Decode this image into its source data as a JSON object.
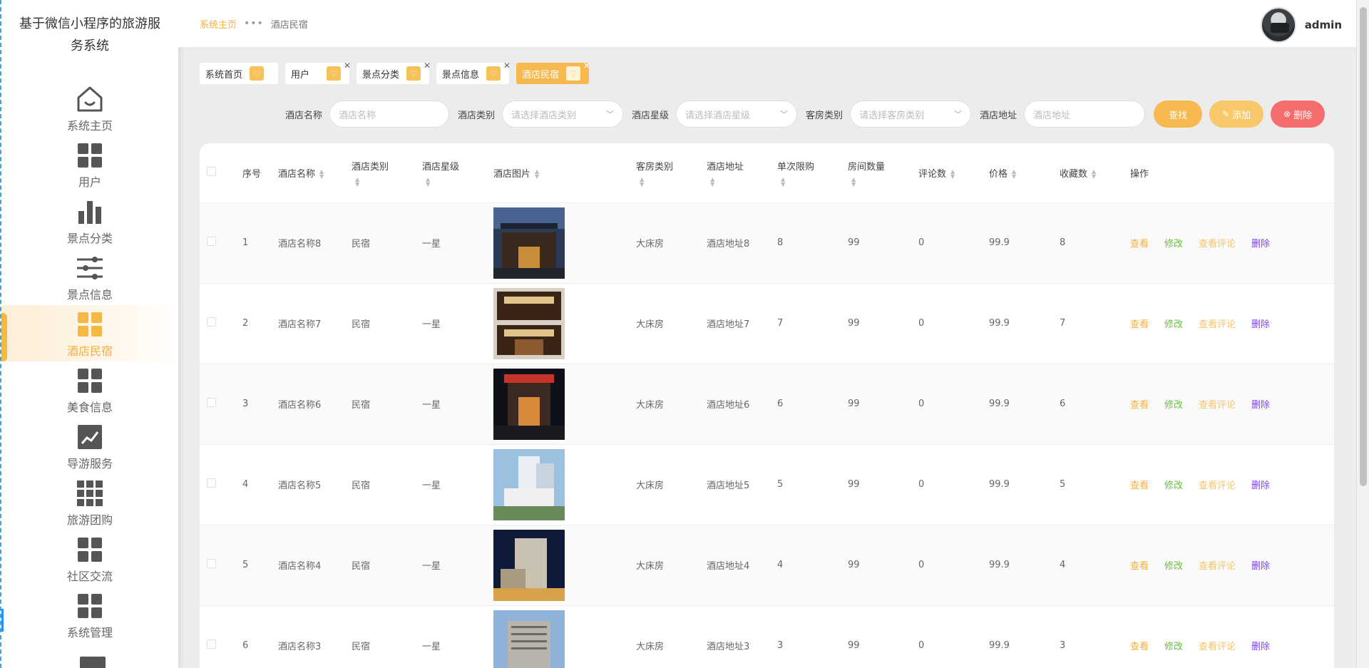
{
  "app": {
    "title": "基于微信小程序的旅游服务系统"
  },
  "sidebar": {
    "items": [
      {
        "label": "系统主页",
        "icon": "home-icon"
      },
      {
        "label": "用户",
        "icon": "grid-icon"
      },
      {
        "label": "景点分类",
        "icon": "bar-chart-icon"
      },
      {
        "label": "景点信息",
        "icon": "sliders-icon"
      },
      {
        "label": "酒店民宿",
        "icon": "grid-icon",
        "active": true
      },
      {
        "label": "美食信息",
        "icon": "grid-icon"
      },
      {
        "label": "导游服务",
        "icon": "trend-chart-icon"
      },
      {
        "label": "旅游团购",
        "icon": "apps-icon"
      },
      {
        "label": "社区交流",
        "icon": "grid-icon"
      },
      {
        "label": "系统管理",
        "icon": "grid-icon"
      }
    ]
  },
  "header": {
    "breadcrumb": [
      "系统主页",
      "酒店民宿"
    ],
    "breadcrumb_sep": "•••",
    "user": "admin"
  },
  "tags": [
    {
      "label": "系统首页",
      "closable": false
    },
    {
      "label": "用户",
      "closable": true
    },
    {
      "label": "景点分类",
      "closable": true
    },
    {
      "label": "景点信息",
      "closable": true
    },
    {
      "label": "酒店民宿",
      "closable": true,
      "active": true
    }
  ],
  "filters": {
    "hotel_name": {
      "label": "酒店名称",
      "placeholder": "酒店名称"
    },
    "hotel_type": {
      "label": "酒店类别",
      "placeholder": "请选择酒店类别"
    },
    "hotel_star": {
      "label": "酒店星级",
      "placeholder": "请选择酒店星级"
    },
    "room_type": {
      "label": "客房类别",
      "placeholder": "请选择客房类别"
    },
    "hotel_addr": {
      "label": "酒店地址",
      "placeholder": "酒店地址"
    },
    "search_btn": "查找",
    "add_btn": "添加",
    "delete_btn": "删除"
  },
  "table": {
    "columns": [
      "序号",
      "酒店名称",
      "酒店类别",
      "酒店星级",
      "酒店图片",
      "客房类别",
      "酒店地址",
      "单次限购",
      "房间数量",
      "评论数",
      "价格",
      "收藏数",
      "操作"
    ],
    "actions": {
      "view": "查看",
      "edit": "修改",
      "comments": "查看评论",
      "delete": "删除"
    },
    "rows": [
      {
        "index": "1",
        "name": "酒店名称8",
        "type": "民宿",
        "star": "一星",
        "room": "大床房",
        "addr": "酒店地址8",
        "limit": "8",
        "rooms": "99",
        "comments": "0",
        "price": "99.9",
        "favorites": "8"
      },
      {
        "index": "2",
        "name": "酒店名称7",
        "type": "民宿",
        "star": "一星",
        "room": "大床房",
        "addr": "酒店地址7",
        "limit": "7",
        "rooms": "99",
        "comments": "0",
        "price": "99.9",
        "favorites": "7"
      },
      {
        "index": "3",
        "name": "酒店名称6",
        "type": "民宿",
        "star": "一星",
        "room": "大床房",
        "addr": "酒店地址6",
        "limit": "6",
        "rooms": "99",
        "comments": "0",
        "price": "99.9",
        "favorites": "6"
      },
      {
        "index": "4",
        "name": "酒店名称5",
        "type": "民宿",
        "star": "一星",
        "room": "大床房",
        "addr": "酒店地址5",
        "limit": "5",
        "rooms": "99",
        "comments": "0",
        "price": "99.9",
        "favorites": "5"
      },
      {
        "index": "5",
        "name": "酒店名称4",
        "type": "民宿",
        "star": "一星",
        "room": "大床房",
        "addr": "酒店地址4",
        "limit": "4",
        "rooms": "99",
        "comments": "0",
        "price": "99.9",
        "favorites": "4"
      },
      {
        "index": "6",
        "name": "酒店名称3",
        "type": "民宿",
        "star": "一星",
        "room": "大床房",
        "addr": "酒店地址3",
        "limit": "3",
        "rooms": "99",
        "comments": "0",
        "price": "99.9",
        "favorites": "3"
      }
    ]
  },
  "colors": {
    "accent": "#f7b94f",
    "danger": "#f56c6c",
    "success": "#67c23a",
    "purple": "#7a4ce0"
  }
}
